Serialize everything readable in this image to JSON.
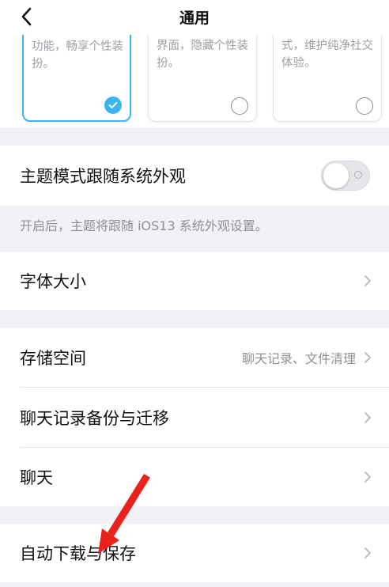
{
  "nav": {
    "title": "通用",
    "back_icon": "chevron-left-icon"
  },
  "themes": [
    {
      "desc": "功能，畅享个性装扮。",
      "selected": true
    },
    {
      "desc": "界面，隐藏个性装扮。",
      "selected": false
    },
    {
      "desc": "式，维护纯净社交体验。",
      "selected": false
    }
  ],
  "theme_follow": {
    "label": "主题模式跟随系统外观",
    "enabled": false,
    "hint": "开启后，主题将跟随 iOS13 系统外观设置。"
  },
  "font_size": {
    "label": "字体大小"
  },
  "storage": {
    "label": "存储空间",
    "value": "聊天记录、文件清理"
  },
  "backup": {
    "label": "聊天记录备份与迁移"
  },
  "chat": {
    "label": "聊天"
  },
  "auto_download": {
    "label": "自动下载与保存"
  },
  "colors": {
    "accent": "#3cb4ee",
    "annotation_arrow": "#e8231e"
  }
}
